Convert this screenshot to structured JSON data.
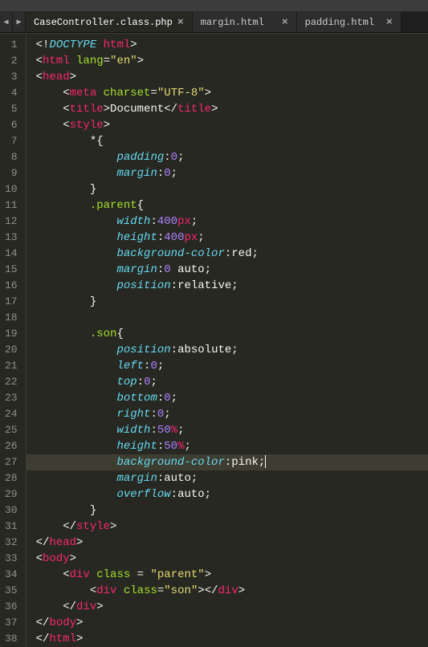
{
  "menubar_text": "",
  "tabs": [
    {
      "label": "CaseController.class.php",
      "active": true
    },
    {
      "label": "margin.html",
      "active": false
    },
    {
      "label": "padding.html",
      "active": false
    }
  ],
  "nav": {
    "prev": "◀",
    "next": "▶"
  },
  "code_lines": [
    {
      "n": 1,
      "ind": 0,
      "tokens": [
        [
          "<",
          "c-bracket"
        ],
        [
          "!",
          "c-bracket"
        ],
        [
          "DOCTYPE",
          "c-doctype"
        ],
        [
          " ",
          "c-text"
        ],
        [
          "html",
          "c-tag"
        ],
        [
          ">",
          "c-bracket"
        ]
      ]
    },
    {
      "n": 2,
      "ind": 0,
      "tokens": [
        [
          "<",
          "c-bracket"
        ],
        [
          "html",
          "c-tag"
        ],
        [
          " ",
          "c-text"
        ],
        [
          "lang",
          "c-attr"
        ],
        [
          "=",
          "c-op"
        ],
        [
          "\"en\"",
          "c-string"
        ],
        [
          ">",
          "c-bracket"
        ]
      ]
    },
    {
      "n": 3,
      "ind": 0,
      "tokens": [
        [
          "<",
          "c-bracket"
        ],
        [
          "head",
          "c-tag"
        ],
        [
          ">",
          "c-bracket"
        ]
      ]
    },
    {
      "n": 4,
      "ind": 1,
      "tokens": [
        [
          "<",
          "c-bracket"
        ],
        [
          "meta",
          "c-tag"
        ],
        [
          " ",
          "c-text"
        ],
        [
          "charset",
          "c-attr"
        ],
        [
          "=",
          "c-op"
        ],
        [
          "\"UTF-8\"",
          "c-string"
        ],
        [
          ">",
          "c-bracket"
        ]
      ]
    },
    {
      "n": 5,
      "ind": 1,
      "tokens": [
        [
          "<",
          "c-bracket"
        ],
        [
          "title",
          "c-tag"
        ],
        [
          ">",
          "c-bracket"
        ],
        [
          "Document",
          "c-text"
        ],
        [
          "</",
          "c-bracket"
        ],
        [
          "title",
          "c-tag"
        ],
        [
          ">",
          "c-bracket"
        ]
      ]
    },
    {
      "n": 6,
      "ind": 1,
      "tokens": [
        [
          "<",
          "c-bracket"
        ],
        [
          "style",
          "c-tag"
        ],
        [
          ">",
          "c-bracket"
        ]
      ]
    },
    {
      "n": 7,
      "ind": 2,
      "tokens": [
        [
          "*",
          "c-op"
        ],
        [
          "{",
          "c-punc"
        ]
      ]
    },
    {
      "n": 8,
      "ind": 3,
      "tokens": [
        [
          "padding",
          "c-prop"
        ],
        [
          ":",
          "c-op"
        ],
        [
          "0",
          "c-num"
        ],
        [
          ";",
          "c-punc"
        ]
      ]
    },
    {
      "n": 9,
      "ind": 3,
      "tokens": [
        [
          "margin",
          "c-prop"
        ],
        [
          ":",
          "c-op"
        ],
        [
          "0",
          "c-num"
        ],
        [
          ";",
          "c-punc"
        ]
      ]
    },
    {
      "n": 10,
      "ind": 2,
      "tokens": [
        [
          "}",
          "c-punc"
        ]
      ]
    },
    {
      "n": 11,
      "ind": 2,
      "tokens": [
        [
          ".parent",
          "c-selector"
        ],
        [
          "{",
          "c-punc"
        ]
      ]
    },
    {
      "n": 12,
      "ind": 3,
      "tokens": [
        [
          "width",
          "c-prop"
        ],
        [
          ":",
          "c-op"
        ],
        [
          "400",
          "c-num"
        ],
        [
          "px",
          "c-keyword"
        ],
        [
          ";",
          "c-punc"
        ]
      ]
    },
    {
      "n": 13,
      "ind": 3,
      "tokens": [
        [
          "height",
          "c-prop"
        ],
        [
          ":",
          "c-op"
        ],
        [
          "400",
          "c-num"
        ],
        [
          "px",
          "c-keyword"
        ],
        [
          ";",
          "c-punc"
        ]
      ]
    },
    {
      "n": 14,
      "ind": 3,
      "tokens": [
        [
          "background-color",
          "c-prop"
        ],
        [
          ":",
          "c-op"
        ],
        [
          "red",
          "c-val"
        ],
        [
          ";",
          "c-punc"
        ]
      ]
    },
    {
      "n": 15,
      "ind": 3,
      "tokens": [
        [
          "margin",
          "c-prop"
        ],
        [
          ":",
          "c-op"
        ],
        [
          "0",
          "c-num"
        ],
        [
          " ",
          "c-text"
        ],
        [
          "auto",
          "c-val"
        ],
        [
          ";",
          "c-punc"
        ]
      ]
    },
    {
      "n": 16,
      "ind": 3,
      "tokens": [
        [
          "position",
          "c-prop"
        ],
        [
          ":",
          "c-op"
        ],
        [
          "relative",
          "c-val"
        ],
        [
          ";",
          "c-punc"
        ]
      ]
    },
    {
      "n": 17,
      "ind": 2,
      "tokens": [
        [
          "}",
          "c-punc"
        ]
      ]
    },
    {
      "n": 18,
      "ind": 0,
      "tokens": []
    },
    {
      "n": 19,
      "ind": 2,
      "tokens": [
        [
          ".son",
          "c-selector"
        ],
        [
          "{",
          "c-punc"
        ]
      ]
    },
    {
      "n": 20,
      "ind": 3,
      "tokens": [
        [
          "position",
          "c-prop"
        ],
        [
          ":",
          "c-op"
        ],
        [
          "absolute",
          "c-val"
        ],
        [
          ";",
          "c-punc"
        ]
      ]
    },
    {
      "n": 21,
      "ind": 3,
      "tokens": [
        [
          "left",
          "c-prop"
        ],
        [
          ":",
          "c-op"
        ],
        [
          "0",
          "c-num"
        ],
        [
          ";",
          "c-punc"
        ]
      ]
    },
    {
      "n": 22,
      "ind": 3,
      "tokens": [
        [
          "top",
          "c-prop"
        ],
        [
          ":",
          "c-op"
        ],
        [
          "0",
          "c-num"
        ],
        [
          ";",
          "c-punc"
        ]
      ]
    },
    {
      "n": 23,
      "ind": 3,
      "tokens": [
        [
          "bottom",
          "c-prop"
        ],
        [
          ":",
          "c-op"
        ],
        [
          "0",
          "c-num"
        ],
        [
          ";",
          "c-punc"
        ]
      ]
    },
    {
      "n": 24,
      "ind": 3,
      "tokens": [
        [
          "right",
          "c-prop"
        ],
        [
          ":",
          "c-op"
        ],
        [
          "0",
          "c-num"
        ],
        [
          ";",
          "c-punc"
        ]
      ]
    },
    {
      "n": 25,
      "ind": 3,
      "tokens": [
        [
          "width",
          "c-prop"
        ],
        [
          ":",
          "c-op"
        ],
        [
          "50",
          "c-num"
        ],
        [
          "%",
          "c-keyword"
        ],
        [
          ";",
          "c-punc"
        ]
      ]
    },
    {
      "n": 26,
      "ind": 3,
      "tokens": [
        [
          "height",
          "c-prop"
        ],
        [
          ":",
          "c-op"
        ],
        [
          "50",
          "c-num"
        ],
        [
          "%",
          "c-keyword"
        ],
        [
          ";",
          "c-punc"
        ]
      ]
    },
    {
      "n": 27,
      "ind": 3,
      "current": true,
      "tokens": [
        [
          "background-color",
          "c-prop"
        ],
        [
          ":",
          "c-op"
        ],
        [
          "pink",
          "c-val"
        ],
        [
          ";",
          "c-punc"
        ]
      ],
      "cursor": true
    },
    {
      "n": 28,
      "ind": 3,
      "tokens": [
        [
          "margin",
          "c-prop"
        ],
        [
          ":",
          "c-op"
        ],
        [
          "auto",
          "c-val"
        ],
        [
          ";",
          "c-punc"
        ]
      ]
    },
    {
      "n": 29,
      "ind": 3,
      "tokens": [
        [
          "overflow",
          "c-prop"
        ],
        [
          ":",
          "c-op"
        ],
        [
          "auto",
          "c-val"
        ],
        [
          ";",
          "c-punc"
        ]
      ]
    },
    {
      "n": 30,
      "ind": 2,
      "tokens": [
        [
          "}",
          "c-punc"
        ]
      ]
    },
    {
      "n": 31,
      "ind": 1,
      "tokens": [
        [
          "</",
          "c-bracket"
        ],
        [
          "style",
          "c-tag"
        ],
        [
          ">",
          "c-bracket"
        ]
      ]
    },
    {
      "n": 32,
      "ind": 0,
      "tokens": [
        [
          "</",
          "c-bracket"
        ],
        [
          "head",
          "c-tag"
        ],
        [
          ">",
          "c-bracket"
        ]
      ]
    },
    {
      "n": 33,
      "ind": 0,
      "tokens": [
        [
          "<",
          "c-bracket"
        ],
        [
          "body",
          "c-tag"
        ],
        [
          ">",
          "c-bracket"
        ]
      ]
    },
    {
      "n": 34,
      "ind": 1,
      "tokens": [
        [
          "<",
          "c-bracket"
        ],
        [
          "div",
          "c-tag"
        ],
        [
          " ",
          "c-text"
        ],
        [
          "class",
          "c-attr"
        ],
        [
          " = ",
          "c-op"
        ],
        [
          "\"parent\"",
          "c-string"
        ],
        [
          ">",
          "c-bracket"
        ]
      ]
    },
    {
      "n": 35,
      "ind": 2,
      "tokens": [
        [
          "<",
          "c-bracket"
        ],
        [
          "div",
          "c-tag"
        ],
        [
          " ",
          "c-text"
        ],
        [
          "class",
          "c-attr"
        ],
        [
          "=",
          "c-op"
        ],
        [
          "\"son\"",
          "c-string"
        ],
        [
          ">",
          "c-bracket"
        ],
        [
          "</",
          "c-bracket"
        ],
        [
          "div",
          "c-tag"
        ],
        [
          ">",
          "c-bracket"
        ]
      ]
    },
    {
      "n": 36,
      "ind": 1,
      "tokens": [
        [
          "</",
          "c-bracket"
        ],
        [
          "div",
          "c-tag"
        ],
        [
          ">",
          "c-bracket"
        ]
      ]
    },
    {
      "n": 37,
      "ind": 0,
      "tokens": [
        [
          "</",
          "c-bracket"
        ],
        [
          "body",
          "c-tag"
        ],
        [
          ">",
          "c-bracket"
        ]
      ]
    },
    {
      "n": 38,
      "ind": 0,
      "tokens": [
        [
          "</",
          "c-bracket"
        ],
        [
          "html",
          "c-tag"
        ],
        [
          ">",
          "c-bracket"
        ]
      ]
    }
  ]
}
